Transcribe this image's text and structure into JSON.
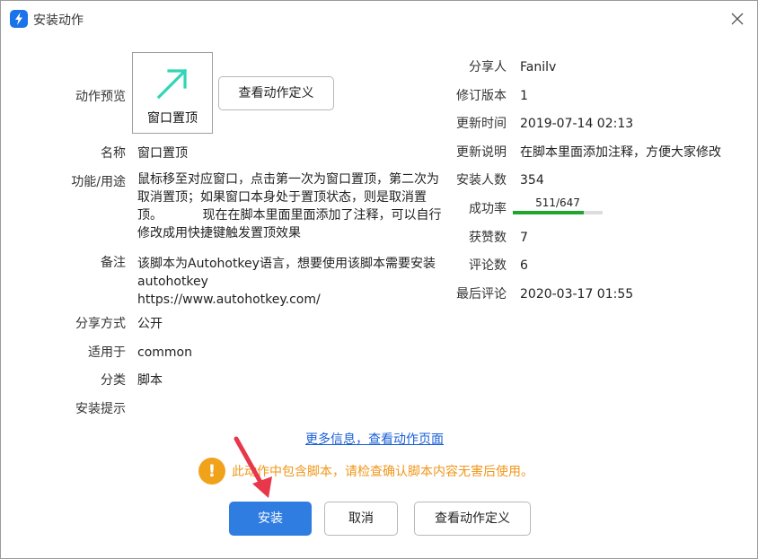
{
  "window": {
    "title": "安装动作"
  },
  "colors": {
    "accent": "#2f7de1",
    "link": "#1a5fd8",
    "warning": "#f1a21b",
    "warning_text": "#f0961a",
    "progress": "#21a52e",
    "preview_icon": "#2fd6b4",
    "annotation_arrow": "#e8364a"
  },
  "preview": {
    "label": "动作预览",
    "icon": "arrow-up-right-icon",
    "name": "窗口置顶",
    "view_definition_button": "查看动作定义"
  },
  "left_fields": {
    "name": {
      "label": "名称",
      "value": "窗口置顶"
    },
    "purpose": {
      "label": "功能/用途",
      "value": "鼠标移至对应窗口，点击第一次为窗口置顶，第二次为取消置顶；如果窗口本身处于置顶状态，则是取消置顶。          现在在脚本里面里面添加了注释，可以自行修改成用快捷键触发置顶效果"
    },
    "remark": {
      "label": "备注",
      "value": "该脚本为Autohotkey语言，想要使用该脚本需要安装autohotkey\nhttps://www.autohotkey.com/"
    },
    "share_mode": {
      "label": "分享方式",
      "value": "公开"
    },
    "applies_to": {
      "label": "适用于",
      "value": "common"
    },
    "category": {
      "label": "分类",
      "value": "脚本"
    },
    "install_hint": {
      "label": "安装提示",
      "value": ""
    }
  },
  "right_fields": {
    "sharer": {
      "label": "分享人",
      "value": "Fanilv"
    },
    "revision": {
      "label": "修订版本",
      "value": "1"
    },
    "updated": {
      "label": "更新时间",
      "value": "2019-07-14 02:13"
    },
    "update_notes": {
      "label": "更新说明",
      "value": "在脚本里面添加注释，方便大家修改"
    },
    "installs": {
      "label": "安装人数",
      "value": "354"
    },
    "success_rate": {
      "label": "成功率",
      "text": "511/647",
      "fraction": 0.79
    },
    "likes": {
      "label": "获赞数",
      "value": "7"
    },
    "comments": {
      "label": "评论数",
      "value": "6"
    },
    "last_comment": {
      "label": "最后评论",
      "value": "2020-03-17 01:55"
    }
  },
  "more_info_link": "更多信息，查看动作页面",
  "warning": {
    "icon_glyph": "!",
    "text": "此动作中包含脚本，请检查确认脚本内容无害后使用。"
  },
  "footer": {
    "install": "安装",
    "cancel": "取消",
    "view_definition": "查看动作定义"
  }
}
